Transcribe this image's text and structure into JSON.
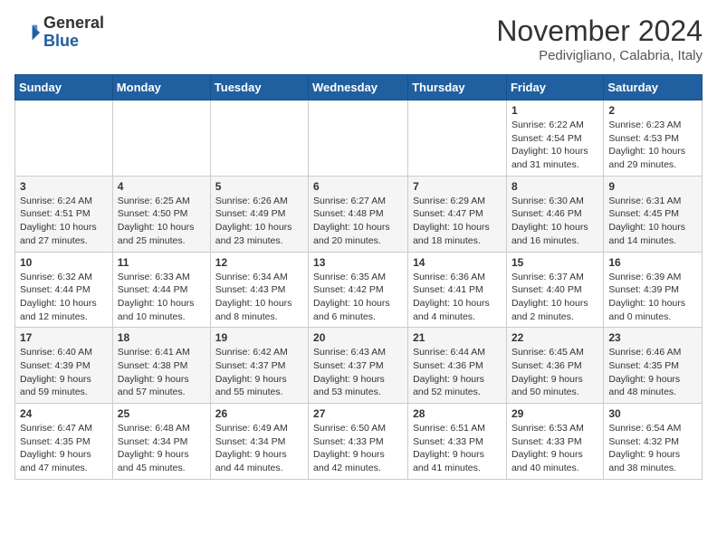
{
  "header": {
    "logo_line1": "General",
    "logo_line2": "Blue",
    "month": "November 2024",
    "location": "Pedivigliano, Calabria, Italy"
  },
  "days_of_week": [
    "Sunday",
    "Monday",
    "Tuesday",
    "Wednesday",
    "Thursday",
    "Friday",
    "Saturday"
  ],
  "weeks": [
    [
      {
        "day": "",
        "info": ""
      },
      {
        "day": "",
        "info": ""
      },
      {
        "day": "",
        "info": ""
      },
      {
        "day": "",
        "info": ""
      },
      {
        "day": "",
        "info": ""
      },
      {
        "day": "1",
        "info": "Sunrise: 6:22 AM\nSunset: 4:54 PM\nDaylight: 10 hours and 31 minutes."
      },
      {
        "day": "2",
        "info": "Sunrise: 6:23 AM\nSunset: 4:53 PM\nDaylight: 10 hours and 29 minutes."
      }
    ],
    [
      {
        "day": "3",
        "info": "Sunrise: 6:24 AM\nSunset: 4:51 PM\nDaylight: 10 hours and 27 minutes."
      },
      {
        "day": "4",
        "info": "Sunrise: 6:25 AM\nSunset: 4:50 PM\nDaylight: 10 hours and 25 minutes."
      },
      {
        "day": "5",
        "info": "Sunrise: 6:26 AM\nSunset: 4:49 PM\nDaylight: 10 hours and 23 minutes."
      },
      {
        "day": "6",
        "info": "Sunrise: 6:27 AM\nSunset: 4:48 PM\nDaylight: 10 hours and 20 minutes."
      },
      {
        "day": "7",
        "info": "Sunrise: 6:29 AM\nSunset: 4:47 PM\nDaylight: 10 hours and 18 minutes."
      },
      {
        "day": "8",
        "info": "Sunrise: 6:30 AM\nSunset: 4:46 PM\nDaylight: 10 hours and 16 minutes."
      },
      {
        "day": "9",
        "info": "Sunrise: 6:31 AM\nSunset: 4:45 PM\nDaylight: 10 hours and 14 minutes."
      }
    ],
    [
      {
        "day": "10",
        "info": "Sunrise: 6:32 AM\nSunset: 4:44 PM\nDaylight: 10 hours and 12 minutes."
      },
      {
        "day": "11",
        "info": "Sunrise: 6:33 AM\nSunset: 4:44 PM\nDaylight: 10 hours and 10 minutes."
      },
      {
        "day": "12",
        "info": "Sunrise: 6:34 AM\nSunset: 4:43 PM\nDaylight: 10 hours and 8 minutes."
      },
      {
        "day": "13",
        "info": "Sunrise: 6:35 AM\nSunset: 4:42 PM\nDaylight: 10 hours and 6 minutes."
      },
      {
        "day": "14",
        "info": "Sunrise: 6:36 AM\nSunset: 4:41 PM\nDaylight: 10 hours and 4 minutes."
      },
      {
        "day": "15",
        "info": "Sunrise: 6:37 AM\nSunset: 4:40 PM\nDaylight: 10 hours and 2 minutes."
      },
      {
        "day": "16",
        "info": "Sunrise: 6:39 AM\nSunset: 4:39 PM\nDaylight: 10 hours and 0 minutes."
      }
    ],
    [
      {
        "day": "17",
        "info": "Sunrise: 6:40 AM\nSunset: 4:39 PM\nDaylight: 9 hours and 59 minutes."
      },
      {
        "day": "18",
        "info": "Sunrise: 6:41 AM\nSunset: 4:38 PM\nDaylight: 9 hours and 57 minutes."
      },
      {
        "day": "19",
        "info": "Sunrise: 6:42 AM\nSunset: 4:37 PM\nDaylight: 9 hours and 55 minutes."
      },
      {
        "day": "20",
        "info": "Sunrise: 6:43 AM\nSunset: 4:37 PM\nDaylight: 9 hours and 53 minutes."
      },
      {
        "day": "21",
        "info": "Sunrise: 6:44 AM\nSunset: 4:36 PM\nDaylight: 9 hours and 52 minutes."
      },
      {
        "day": "22",
        "info": "Sunrise: 6:45 AM\nSunset: 4:36 PM\nDaylight: 9 hours and 50 minutes."
      },
      {
        "day": "23",
        "info": "Sunrise: 6:46 AM\nSunset: 4:35 PM\nDaylight: 9 hours and 48 minutes."
      }
    ],
    [
      {
        "day": "24",
        "info": "Sunrise: 6:47 AM\nSunset: 4:35 PM\nDaylight: 9 hours and 47 minutes."
      },
      {
        "day": "25",
        "info": "Sunrise: 6:48 AM\nSunset: 4:34 PM\nDaylight: 9 hours and 45 minutes."
      },
      {
        "day": "26",
        "info": "Sunrise: 6:49 AM\nSunset: 4:34 PM\nDaylight: 9 hours and 44 minutes."
      },
      {
        "day": "27",
        "info": "Sunrise: 6:50 AM\nSunset: 4:33 PM\nDaylight: 9 hours and 42 minutes."
      },
      {
        "day": "28",
        "info": "Sunrise: 6:51 AM\nSunset: 4:33 PM\nDaylight: 9 hours and 41 minutes."
      },
      {
        "day": "29",
        "info": "Sunrise: 6:53 AM\nSunset: 4:33 PM\nDaylight: 9 hours and 40 minutes."
      },
      {
        "day": "30",
        "info": "Sunrise: 6:54 AM\nSunset: 4:32 PM\nDaylight: 9 hours and 38 minutes."
      }
    ]
  ]
}
